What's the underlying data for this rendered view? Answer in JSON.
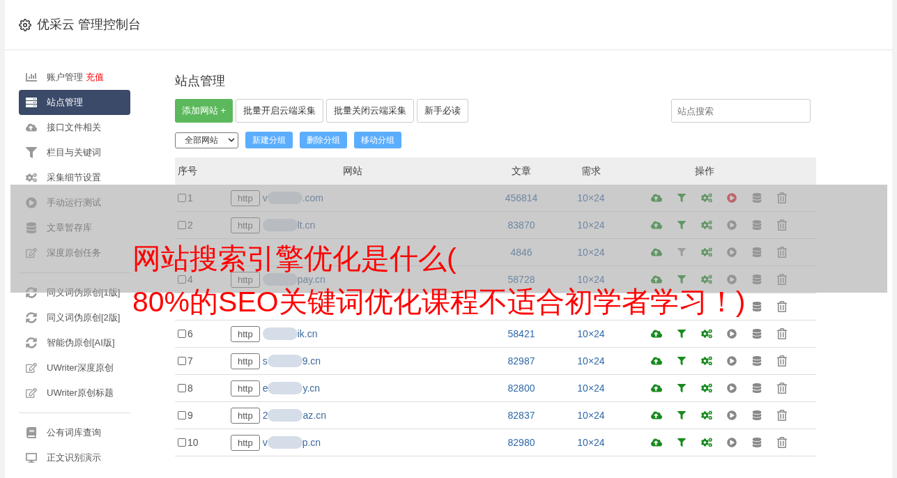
{
  "header": {
    "title": "优采云 管理控制台"
  },
  "sidebar": {
    "groups": [
      [
        {
          "label": "账户管理",
          "badge": "充值",
          "selected": false
        },
        {
          "label": "站点管理",
          "selected": true
        },
        {
          "label": "接口文件相关",
          "selected": false
        },
        {
          "label": "栏目与关键词",
          "selected": false
        },
        {
          "label": "采集细节设置",
          "selected": false
        },
        {
          "label": "手动运行测试",
          "selected": false
        },
        {
          "label": "文章暂存库",
          "selected": false
        },
        {
          "label": "深度原创任务",
          "selected": false
        }
      ],
      [
        {
          "label": "同义词伪原创[1版]",
          "selected": false
        },
        {
          "label": "同义词伪原创[2版]",
          "selected": false
        },
        {
          "label": "智能伪原创[AI版]",
          "selected": false
        },
        {
          "label": "UWriter深度原创",
          "selected": false
        },
        {
          "label": "UWriter原创标题",
          "selected": false
        }
      ],
      [
        {
          "label": "公有词库查询",
          "selected": false
        },
        {
          "label": "正文识别演示",
          "selected": false
        }
      ]
    ]
  },
  "main": {
    "title": "站点管理",
    "toolbar": [
      {
        "label": "添加网站 +",
        "kind": "primary"
      },
      {
        "label": "批量开启云端采集",
        "kind": "default"
      },
      {
        "label": "批量关闭云端采集",
        "kind": "default"
      },
      {
        "label": "新手必读",
        "kind": "default"
      }
    ],
    "search": {
      "placeholder": "站点搜索"
    },
    "group_select": {
      "value": "全部网站"
    },
    "group_buttons": [
      "新建分组",
      "删除分组",
      "移动分组"
    ],
    "table": {
      "columns": [
        "序号",
        "网站",
        "文章",
        "需求",
        "操作"
      ],
      "rows": [
        {
          "no": "1",
          "checked": false,
          "protocol": "http",
          "site_start": "v",
          "site_end": ".com",
          "articles": "456814",
          "demand": "10×24",
          "filter_on": true,
          "running": true
        },
        {
          "no": "2",
          "checked": false,
          "protocol": "http",
          "site_end": "lt.cn",
          "articles": "83870",
          "demand": "10×24",
          "filter_on": true,
          "running": false
        },
        {
          "articles": "4846",
          "demand": "10×24",
          "filter_on": false,
          "running": false
        },
        {
          "no": "4",
          "checked": false,
          "protocol": "http",
          "site_end": "pay.cn",
          "articles": "58728",
          "demand": "10×24",
          "filter_on": true,
          "running": false
        },
        {
          "kind": "covered"
        },
        {
          "no": "6",
          "checked": false,
          "protocol": "http",
          "site_end": "ik.cn",
          "articles": "58421",
          "demand": "10×24",
          "filter_on": true,
          "running": false
        },
        {
          "no": "7",
          "checked": false,
          "protocol": "http",
          "site_start": "s",
          "site_end": "9.cn",
          "articles": "82987",
          "demand": "10×24",
          "filter_on": true,
          "running": false
        },
        {
          "no": "8",
          "checked": false,
          "protocol": "http",
          "site_start": "e",
          "site_end": "y.cn",
          "articles": "82800",
          "demand": "10×24",
          "filter_on": true,
          "running": false
        },
        {
          "no": "9",
          "checked": false,
          "protocol": "http",
          "site_start": "2",
          "site_end": "az.cn",
          "articles": "82837",
          "demand": "10×24",
          "filter_on": true,
          "running": false
        },
        {
          "no": "10",
          "checked": false,
          "protocol": "http",
          "site_start": "v",
          "site_end": "p.cn",
          "articles": "82980",
          "demand": "10×24",
          "filter_on": true,
          "running": false
        }
      ]
    }
  },
  "overlay": {
    "lines": [
      "网站搜索引擎优化是什么(",
      "80%的SEO关键词优化课程不适合初学者学习！)"
    ]
  }
}
